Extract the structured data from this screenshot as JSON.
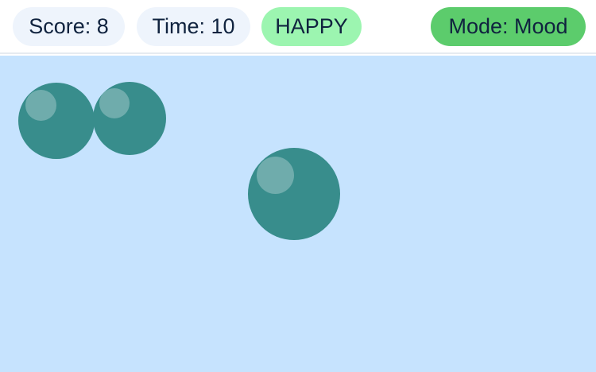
{
  "hud": {
    "score_label": "Score: 8",
    "time_label": "Time: 10",
    "mood_label": "HAPPY",
    "mode_label": "Mode: Mood"
  },
  "colors": {
    "playfield": "#c6e3fe",
    "bubble": "#388d8c",
    "mood_badge": "#9cf5b0",
    "mode_button": "#5ccc6c",
    "stat_pill": "#eef4fc",
    "text": "#10233f"
  },
  "bubbles": [
    {
      "name": "bubble-1",
      "color": "#388d8c"
    },
    {
      "name": "bubble-2",
      "color": "#388d8c"
    },
    {
      "name": "bubble-3",
      "color": "#388d8c"
    }
  ]
}
